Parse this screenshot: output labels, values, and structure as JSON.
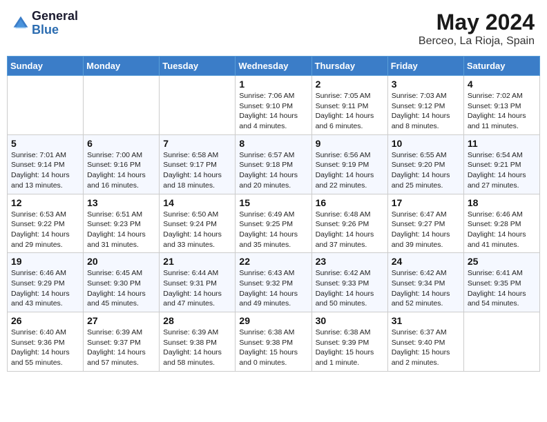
{
  "header": {
    "logo_general": "General",
    "logo_blue": "Blue",
    "title": "May 2024",
    "location": "Berceo, La Rioja, Spain"
  },
  "weekdays": [
    "Sunday",
    "Monday",
    "Tuesday",
    "Wednesday",
    "Thursday",
    "Friday",
    "Saturday"
  ],
  "weeks": [
    [
      {
        "day": "",
        "info": ""
      },
      {
        "day": "",
        "info": ""
      },
      {
        "day": "",
        "info": ""
      },
      {
        "day": "1",
        "info": "Sunrise: 7:06 AM\nSunset: 9:10 PM\nDaylight: 14 hours\nand 4 minutes."
      },
      {
        "day": "2",
        "info": "Sunrise: 7:05 AM\nSunset: 9:11 PM\nDaylight: 14 hours\nand 6 minutes."
      },
      {
        "day": "3",
        "info": "Sunrise: 7:03 AM\nSunset: 9:12 PM\nDaylight: 14 hours\nand 8 minutes."
      },
      {
        "day": "4",
        "info": "Sunrise: 7:02 AM\nSunset: 9:13 PM\nDaylight: 14 hours\nand 11 minutes."
      }
    ],
    [
      {
        "day": "5",
        "info": "Sunrise: 7:01 AM\nSunset: 9:14 PM\nDaylight: 14 hours\nand 13 minutes."
      },
      {
        "day": "6",
        "info": "Sunrise: 7:00 AM\nSunset: 9:16 PM\nDaylight: 14 hours\nand 16 minutes."
      },
      {
        "day": "7",
        "info": "Sunrise: 6:58 AM\nSunset: 9:17 PM\nDaylight: 14 hours\nand 18 minutes."
      },
      {
        "day": "8",
        "info": "Sunrise: 6:57 AM\nSunset: 9:18 PM\nDaylight: 14 hours\nand 20 minutes."
      },
      {
        "day": "9",
        "info": "Sunrise: 6:56 AM\nSunset: 9:19 PM\nDaylight: 14 hours\nand 22 minutes."
      },
      {
        "day": "10",
        "info": "Sunrise: 6:55 AM\nSunset: 9:20 PM\nDaylight: 14 hours\nand 25 minutes."
      },
      {
        "day": "11",
        "info": "Sunrise: 6:54 AM\nSunset: 9:21 PM\nDaylight: 14 hours\nand 27 minutes."
      }
    ],
    [
      {
        "day": "12",
        "info": "Sunrise: 6:53 AM\nSunset: 9:22 PM\nDaylight: 14 hours\nand 29 minutes."
      },
      {
        "day": "13",
        "info": "Sunrise: 6:51 AM\nSunset: 9:23 PM\nDaylight: 14 hours\nand 31 minutes."
      },
      {
        "day": "14",
        "info": "Sunrise: 6:50 AM\nSunset: 9:24 PM\nDaylight: 14 hours\nand 33 minutes."
      },
      {
        "day": "15",
        "info": "Sunrise: 6:49 AM\nSunset: 9:25 PM\nDaylight: 14 hours\nand 35 minutes."
      },
      {
        "day": "16",
        "info": "Sunrise: 6:48 AM\nSunset: 9:26 PM\nDaylight: 14 hours\nand 37 minutes."
      },
      {
        "day": "17",
        "info": "Sunrise: 6:47 AM\nSunset: 9:27 PM\nDaylight: 14 hours\nand 39 minutes."
      },
      {
        "day": "18",
        "info": "Sunrise: 6:46 AM\nSunset: 9:28 PM\nDaylight: 14 hours\nand 41 minutes."
      }
    ],
    [
      {
        "day": "19",
        "info": "Sunrise: 6:46 AM\nSunset: 9:29 PM\nDaylight: 14 hours\nand 43 minutes."
      },
      {
        "day": "20",
        "info": "Sunrise: 6:45 AM\nSunset: 9:30 PM\nDaylight: 14 hours\nand 45 minutes."
      },
      {
        "day": "21",
        "info": "Sunrise: 6:44 AM\nSunset: 9:31 PM\nDaylight: 14 hours\nand 47 minutes."
      },
      {
        "day": "22",
        "info": "Sunrise: 6:43 AM\nSunset: 9:32 PM\nDaylight: 14 hours\nand 49 minutes."
      },
      {
        "day": "23",
        "info": "Sunrise: 6:42 AM\nSunset: 9:33 PM\nDaylight: 14 hours\nand 50 minutes."
      },
      {
        "day": "24",
        "info": "Sunrise: 6:42 AM\nSunset: 9:34 PM\nDaylight: 14 hours\nand 52 minutes."
      },
      {
        "day": "25",
        "info": "Sunrise: 6:41 AM\nSunset: 9:35 PM\nDaylight: 14 hours\nand 54 minutes."
      }
    ],
    [
      {
        "day": "26",
        "info": "Sunrise: 6:40 AM\nSunset: 9:36 PM\nDaylight: 14 hours\nand 55 minutes."
      },
      {
        "day": "27",
        "info": "Sunrise: 6:39 AM\nSunset: 9:37 PM\nDaylight: 14 hours\nand 57 minutes."
      },
      {
        "day": "28",
        "info": "Sunrise: 6:39 AM\nSunset: 9:38 PM\nDaylight: 14 hours\nand 58 minutes."
      },
      {
        "day": "29",
        "info": "Sunrise: 6:38 AM\nSunset: 9:38 PM\nDaylight: 15 hours\nand 0 minutes."
      },
      {
        "day": "30",
        "info": "Sunrise: 6:38 AM\nSunset: 9:39 PM\nDaylight: 15 hours\nand 1 minute."
      },
      {
        "day": "31",
        "info": "Sunrise: 6:37 AM\nSunset: 9:40 PM\nDaylight: 15 hours\nand 2 minutes."
      },
      {
        "day": "",
        "info": ""
      }
    ]
  ]
}
